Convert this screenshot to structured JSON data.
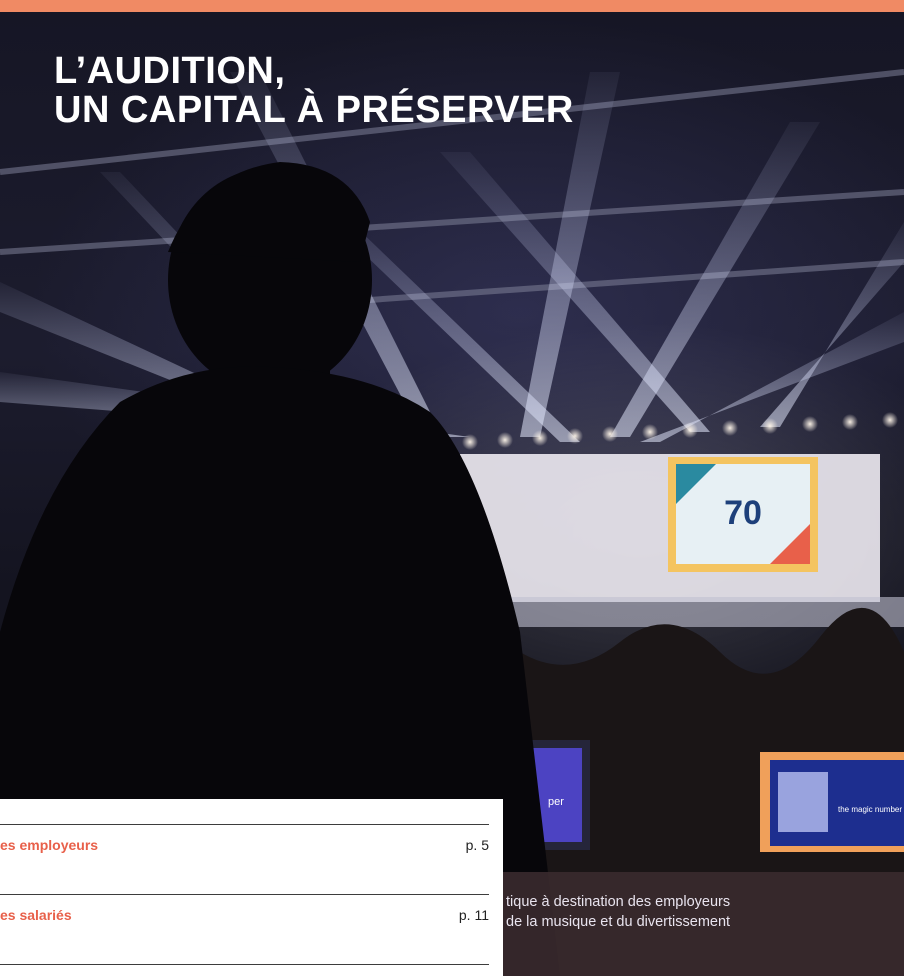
{
  "cover": {
    "title_line1": "L’AUDITION,",
    "title_line2": "UN CAPITAL À PRÉSERVER",
    "tagline_line1": "tique à destination des employeurs",
    "tagline_line2": "de la musique et du divertissement",
    "screen_text_left": "per",
    "screen_text_right": "the magic number",
    "stage_logo_number": "70",
    "accent_color": "#f08a64"
  },
  "toc": {
    "items": [
      {
        "label": "es employeurs",
        "page": "p. 5"
      },
      {
        "label": "es salariés",
        "page": "p. 11"
      }
    ]
  }
}
